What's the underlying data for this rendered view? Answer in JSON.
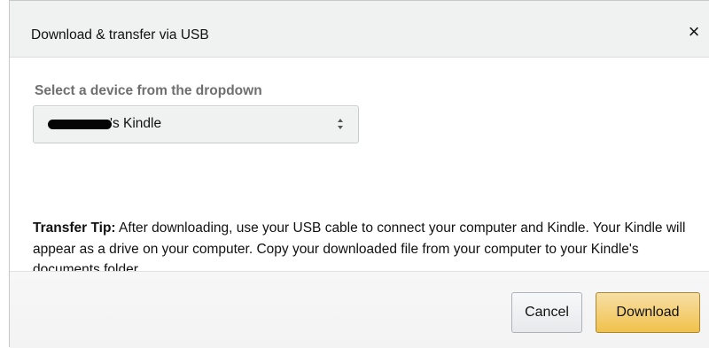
{
  "dialog": {
    "title": "Download & transfer via USB",
    "close_glyph": "×"
  },
  "device_select": {
    "label": "Select a device from the dropdown",
    "selected_value_suffix": "'s Kindle",
    "arrows_glyph": "⬍",
    "arrow_icon": "updown-chevron-icon"
  },
  "transfer_tip": {
    "label": "Transfer Tip:",
    "text": " After downloading, use your USB cable to connect your computer and Kindle. Your Kindle will appear as a drive on your computer. Copy your downloaded file from your computer to your Kindle's documents folder."
  },
  "footer": {
    "cancel_label": "Cancel",
    "download_label": "Download"
  },
  "colors": {
    "header_bg": "#f0f2f2",
    "download_button_top": "#f7dfa5",
    "download_button_bottom": "#f0c14b",
    "download_button_border": "#a88734",
    "label_gray": "#6f6f6f"
  }
}
